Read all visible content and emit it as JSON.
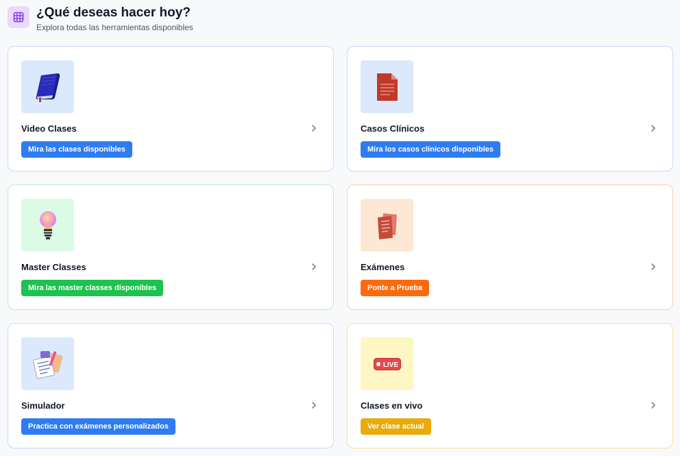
{
  "header": {
    "title": "¿Qué deseas hacer hoy?",
    "subtitle": "Explora todas las herramientas disponibles",
    "icon": "grid-icon",
    "icon_color": "#7c3aed"
  },
  "cards": [
    {
      "title": "Video Clases",
      "action": "Mira las clases disponibles",
      "icon": "book-icon",
      "accent": "#2f7cf1"
    },
    {
      "title": "Casos Clínicos",
      "action": "Mira los casos clínicos disponibles",
      "icon": "document-icon",
      "accent": "#2f7cf1"
    },
    {
      "title": "Master Classes",
      "action": "Mira las master classes disponibles",
      "icon": "lightbulb-icon",
      "accent": "#1ec24e"
    },
    {
      "title": "Exámenes",
      "action": "Ponte a Prueba",
      "icon": "exam-papers-icon",
      "accent": "#fb6a0c"
    },
    {
      "title": "Simulador",
      "action": "Practica con exámenes personalizados",
      "icon": "calculator-icon",
      "accent": "#2f7cf1"
    },
    {
      "title": "Clases en vivo",
      "action": "Ver clase actual",
      "icon": "live-badge-icon",
      "accent": "#e8ab0b",
      "badge_text": "LIVE"
    }
  ]
}
